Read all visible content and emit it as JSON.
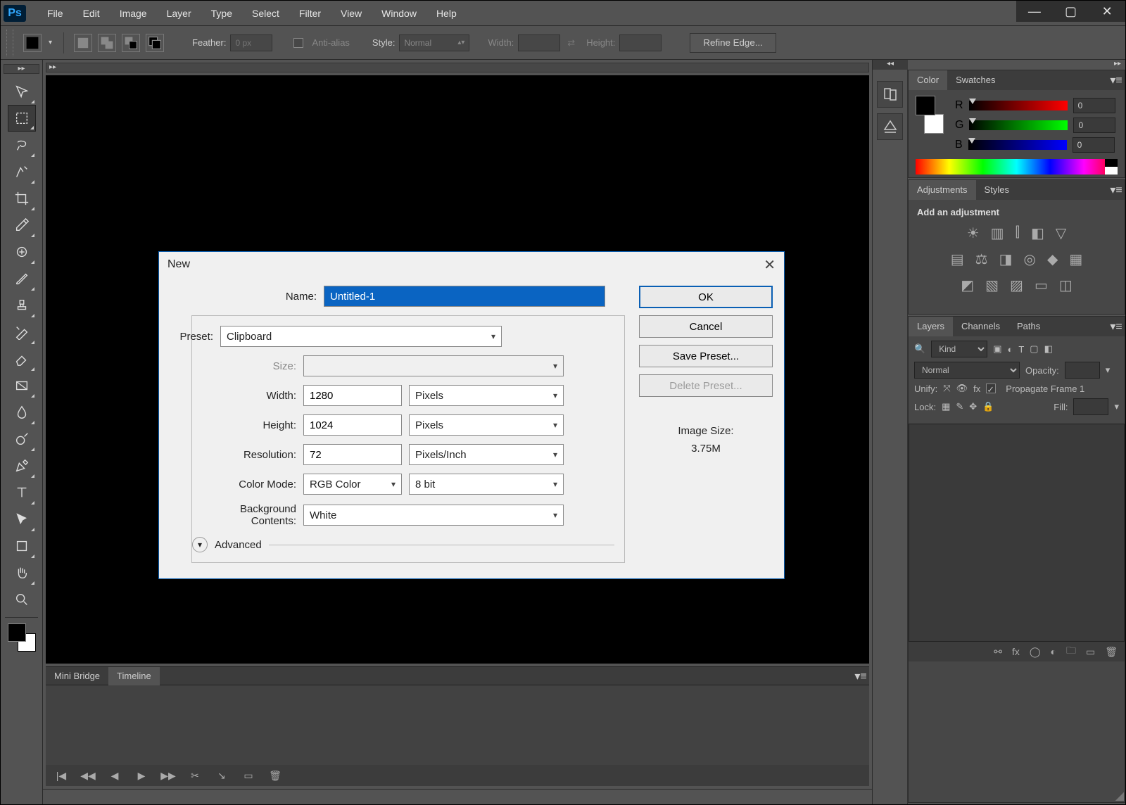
{
  "menu": {
    "items": [
      "File",
      "Edit",
      "Image",
      "Layer",
      "Type",
      "Select",
      "Filter",
      "View",
      "Window",
      "Help"
    ]
  },
  "options_bar": {
    "feather_label": "Feather:",
    "feather_value": "0 px",
    "antialias_label": "Anti-alias",
    "style_label": "Style:",
    "style_value": "Normal",
    "width_label": "Width:",
    "height_label": "Height:",
    "refine_edge_label": "Refine Edge..."
  },
  "bottom_panel": {
    "tabs": [
      "Mini Bridge",
      "Timeline"
    ],
    "active": 1
  },
  "right": {
    "color_tab": "Color",
    "swatches_tab": "Swatches",
    "rgb": {
      "r_label": "R",
      "g_label": "G",
      "b_label": "B",
      "r": "0",
      "g": "0",
      "b": "0"
    },
    "adjustments_tab": "Adjustments",
    "styles_tab": "Styles",
    "adjustments_title": "Add an adjustment",
    "layers_tab": "Layers",
    "channels_tab": "Channels",
    "paths_tab": "Paths",
    "kind_label": "Kind",
    "blend_mode": "Normal",
    "opacity_label": "Opacity:",
    "unify_label": "Unify:",
    "propagate_label": "Propagate Frame 1",
    "lock_label": "Lock:",
    "fill_label": "Fill:"
  },
  "dialog": {
    "title": "New",
    "name_label": "Name:",
    "name_value": "Untitled-1",
    "preset_label": "Preset:",
    "preset_value": "Clipboard",
    "size_label": "Size:",
    "size_value": "",
    "width_label": "Width:",
    "width_value": "1280",
    "width_unit": "Pixels",
    "height_label": "Height:",
    "height_value": "1024",
    "height_unit": "Pixels",
    "res_label": "Resolution:",
    "res_value": "72",
    "res_unit": "Pixels/Inch",
    "mode_label": "Color Mode:",
    "mode_value": "RGB Color",
    "depth_value": "8 bit",
    "bg_label": "Background Contents:",
    "bg_value": "White",
    "advanced_label": "Advanced",
    "ok": "OK",
    "cancel": "Cancel",
    "save_preset": "Save Preset...",
    "delete_preset": "Delete Preset...",
    "image_size_label": "Image Size:",
    "image_size_value": "3.75M"
  }
}
